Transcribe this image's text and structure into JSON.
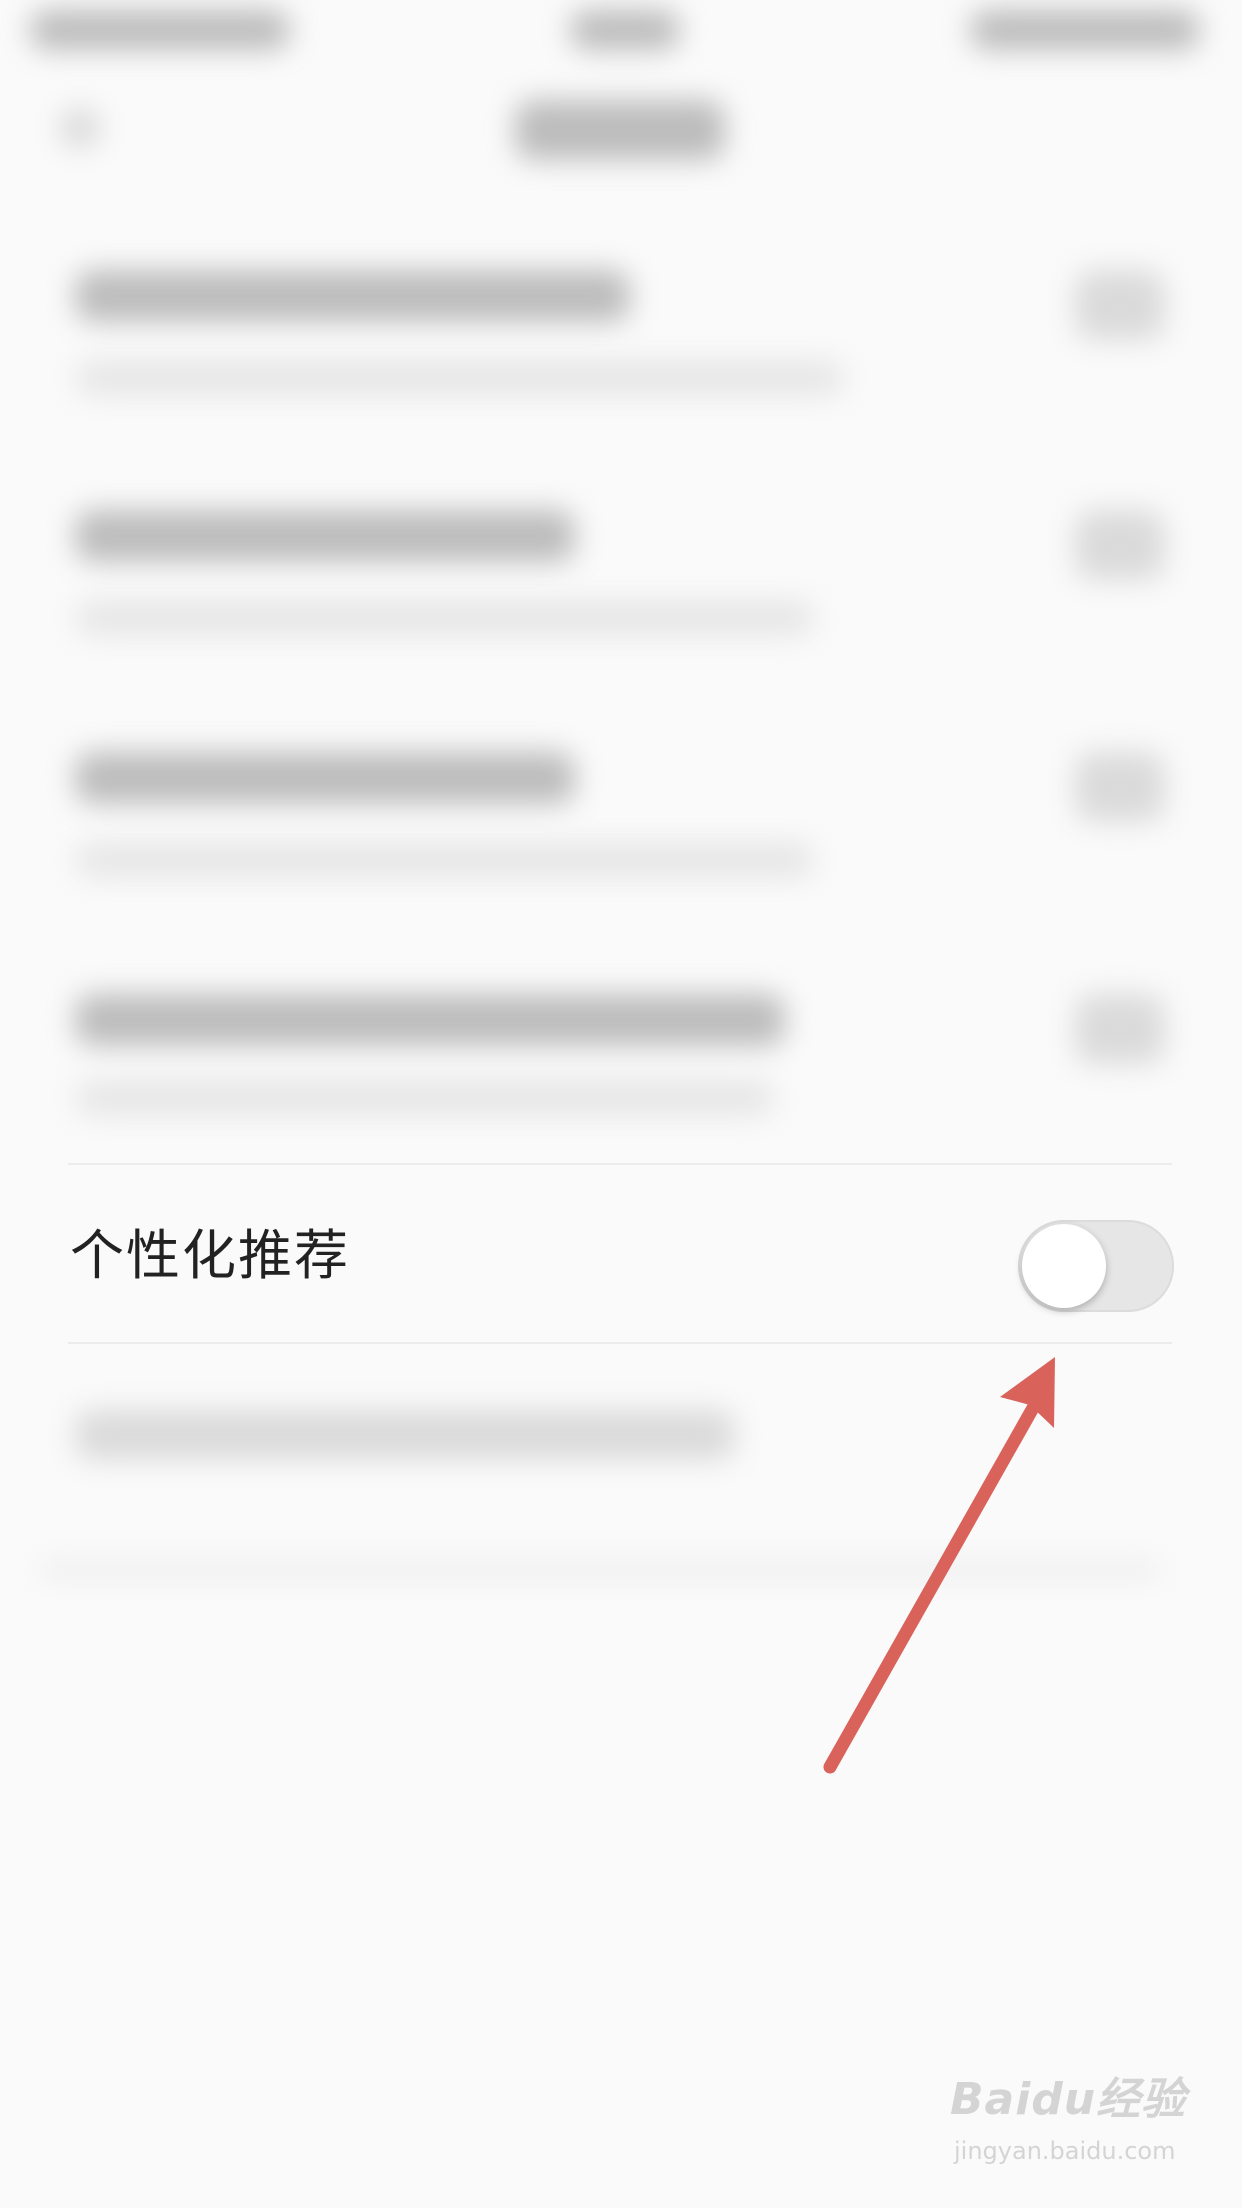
{
  "setting": {
    "label": "个性化推荐",
    "enabled": false
  },
  "annotation": {
    "arrow_color": "#d9625b"
  },
  "watermark": {
    "logo_text": "Baidu经验",
    "url": "jingyan.baidu.com"
  }
}
